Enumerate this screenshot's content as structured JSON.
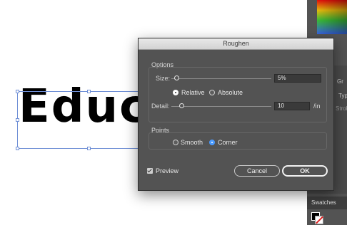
{
  "canvas": {
    "artwork_text": "Educk"
  },
  "right_panel": {
    "letters_a": "Gr",
    "letters_b": "Typ",
    "letters_c": "Strok",
    "swatches_tab": "Swatches"
  },
  "dialog": {
    "title": "Roughen",
    "options_label": "Options",
    "size_label": "Size:",
    "size_value": "5%",
    "size_slider_fraction": 0.05,
    "relative_label": "Relative",
    "absolute_label": "Absolute",
    "size_mode_selected": "Relative",
    "detail_label": "Detail:",
    "detail_value": "10",
    "detail_unit": "/in",
    "detail_slider_fraction": 0.1,
    "points_label": "Points",
    "smooth_label": "Smooth",
    "corner_label": "Corner",
    "points_selected": "Corner",
    "preview_label": "Preview",
    "preview_checked": true,
    "cancel_label": "Cancel",
    "ok_label": "OK"
  },
  "colors": {
    "dialog_bg": "#535353",
    "accent_blue": "#4b9bff",
    "selection_blue": "#6f8fd6"
  }
}
